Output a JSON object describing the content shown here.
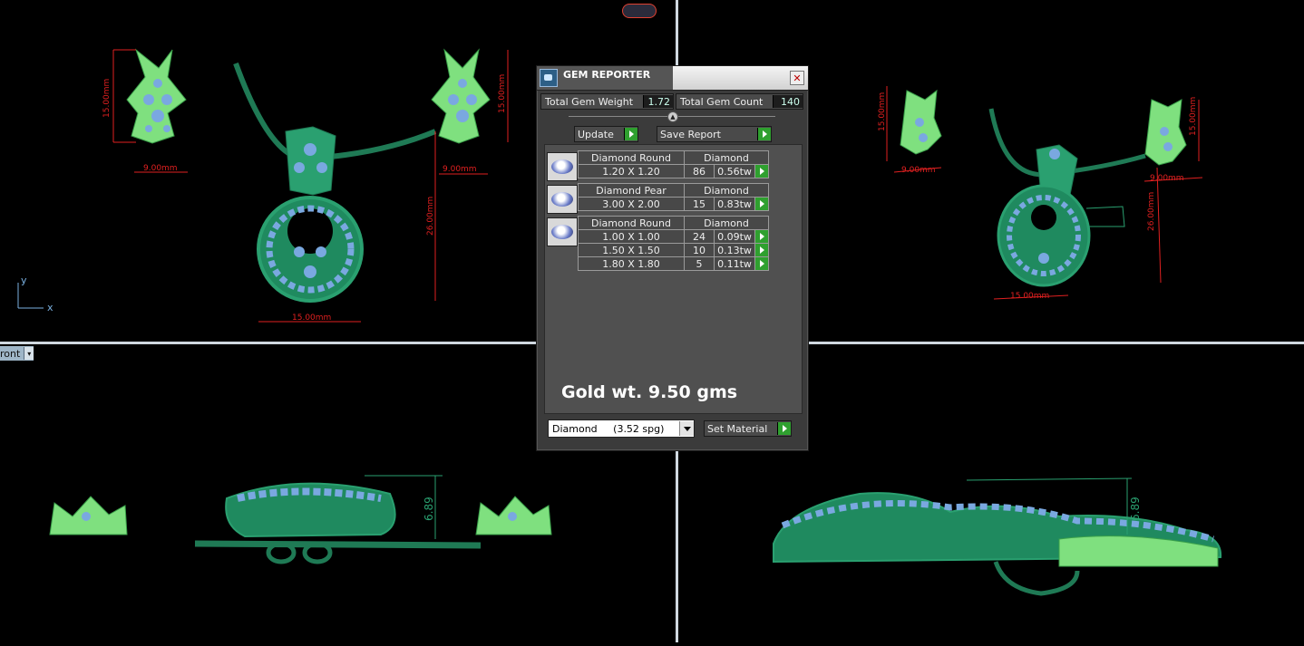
{
  "app": {
    "dialog_title": "GEM REPORTER",
    "close_glyph": "✕",
    "total_weight_label": "Total Gem Weight",
    "total_weight_value": "1.72",
    "total_count_label": "Total Gem Count",
    "total_count_value": "140",
    "update_label": "Update",
    "save_report_label": "Save Report",
    "gold_note": "Gold wt. 9.50 gms",
    "material_select": "Diamond     (3.52 spg)",
    "set_material_label": "Set Material"
  },
  "gems": [
    {
      "name": "Diamond Round",
      "material": "Diamond",
      "rows": [
        {
          "size": "1.20 X 1.20",
          "count": "86",
          "weight": "0.56tw"
        }
      ]
    },
    {
      "name": "Diamond Pear",
      "material": "Diamond",
      "rows": [
        {
          "size": "3.00 X 2.00",
          "count": "15",
          "weight": "0.83tw"
        }
      ]
    },
    {
      "name": "Diamond Round",
      "material": "Diamond",
      "rows": [
        {
          "size": "1.00 X 1.00",
          "count": "24",
          "weight": "0.09tw"
        },
        {
          "size": "1.50 X 1.50",
          "count": "10",
          "weight": "0.13tw"
        },
        {
          "size": "1.80 X 1.80",
          "count": "5",
          "weight": "0.11tw"
        }
      ]
    }
  ],
  "viewport": {
    "tab_label": "ront",
    "axis_y": "y",
    "axis_x": "x",
    "dims_top_left": {
      "earring_left_height": "15.00mm",
      "earring_left_width": "9.00mm",
      "earring_right_height": "15.00mm",
      "earring_right_width": "9.00mm",
      "pendant_height": "26.00mm",
      "pendant_width": "15.00mm"
    },
    "dims_top_right": {
      "earring_left_height": "15.00mm",
      "earring_left_width": "9.00mm",
      "earring_right_height": "15.00mm",
      "earring_right_width": "9.00mm",
      "pendant_height": "26.00mm",
      "pendant_width": "15.00mm"
    },
    "dim_bottom_left": "6.89",
    "dim_bottom_right": "6.89"
  }
}
